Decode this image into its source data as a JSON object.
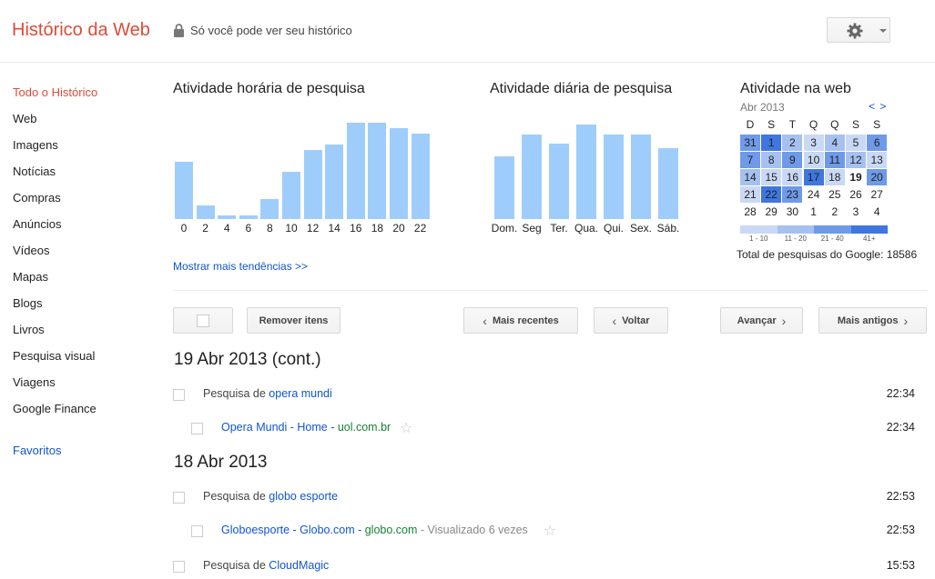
{
  "header": {
    "title": "Histórico da Web",
    "privacy_note": "Só você pode ver seu histórico"
  },
  "sidebar": {
    "items": [
      {
        "label": "Todo o Histórico",
        "active": true
      },
      {
        "label": "Web"
      },
      {
        "label": "Imagens"
      },
      {
        "label": "Notícias"
      },
      {
        "label": "Compras"
      },
      {
        "label": "Anúncios"
      },
      {
        "label": "Vídeos"
      },
      {
        "label": "Mapas"
      },
      {
        "label": "Blogs"
      },
      {
        "label": "Livros"
      },
      {
        "label": "Pesquisa visual"
      },
      {
        "label": "Viagens"
      },
      {
        "label": "Google Finance"
      }
    ],
    "favorites": "Favoritos"
  },
  "chart_data": [
    {
      "type": "bar",
      "title": "Atividade horária de pesquisa",
      "categories": [
        "0",
        "2",
        "4",
        "6",
        "8",
        "10",
        "12",
        "14",
        "16",
        "18",
        "20",
        "22"
      ],
      "values": [
        63,
        15,
        4,
        4,
        22,
        52,
        76,
        82,
        106,
        106,
        100,
        94
      ],
      "color": "#9fcdfb"
    },
    {
      "type": "bar",
      "title": "Atividade diária de pesquisa",
      "categories": [
        "Dom.",
        "Seg",
        "Ter.",
        "Qua.",
        "Qui.",
        "Sex.",
        "Sáb."
      ],
      "values": [
        69,
        93,
        83,
        104,
        93,
        93,
        78
      ],
      "color": "#9fcdfb"
    }
  ],
  "calendar": {
    "title": "Atividade na web",
    "month": "Abr 2013",
    "nav": "< >",
    "weekdays": [
      "D",
      "S",
      "T",
      "Q",
      "Q",
      "S",
      "S"
    ],
    "weeks": [
      [
        {
          "d": "31",
          "lvl": 3
        },
        {
          "d": "1",
          "lvl": 4
        },
        {
          "d": "2",
          "lvl": 2
        },
        {
          "d": "3",
          "lvl": 1
        },
        {
          "d": "4",
          "lvl": 2
        },
        {
          "d": "5",
          "lvl": 1
        },
        {
          "d": "6",
          "lvl": 3
        }
      ],
      [
        {
          "d": "7",
          "lvl": 3
        },
        {
          "d": "8",
          "lvl": 2
        },
        {
          "d": "9",
          "lvl": 3
        },
        {
          "d": "10",
          "lvl": 1
        },
        {
          "d": "11",
          "lvl": 3
        },
        {
          "d": "12",
          "lvl": 2
        },
        {
          "d": "13",
          "lvl": 1
        }
      ],
      [
        {
          "d": "14",
          "lvl": 2
        },
        {
          "d": "15",
          "lvl": 1
        },
        {
          "d": "16",
          "lvl": 1
        },
        {
          "d": "17",
          "lvl": 4
        },
        {
          "d": "18",
          "lvl": 1
        },
        {
          "d": "19",
          "lvl": 0,
          "bold": true
        },
        {
          "d": "20",
          "lvl": 3
        }
      ],
      [
        {
          "d": "21",
          "lvl": 1
        },
        {
          "d": "22",
          "lvl": 4
        },
        {
          "d": "23",
          "lvl": 3
        },
        {
          "d": "24",
          "lvl": 0
        },
        {
          "d": "25",
          "lvl": 0
        },
        {
          "d": "26",
          "lvl": 0
        },
        {
          "d": "27",
          "lvl": 0
        }
      ],
      [
        {
          "d": "28",
          "lvl": 0
        },
        {
          "d": "29",
          "lvl": 0
        },
        {
          "d": "30",
          "lvl": 0
        },
        {
          "d": "1",
          "lvl": 0
        },
        {
          "d": "2",
          "lvl": 0
        },
        {
          "d": "3",
          "lvl": 0
        },
        {
          "d": "4",
          "lvl": 0
        }
      ]
    ],
    "legend": [
      "1 - 10",
      "11 - 20",
      "21 - 40",
      "41+"
    ],
    "level_colors": [
      "#ffffff",
      "#c9d9f5",
      "#a6c1f0",
      "#6e9ae8",
      "#3f76df"
    ],
    "total": "Total de pesquisas do Google: 18586"
  },
  "more_trends": "Mostrar mais tendências >>",
  "toolbar": {
    "remove": "Remover itens",
    "newer": "Mais recentes",
    "back": "Voltar",
    "forward": "Avançar",
    "older": "Mais antigos"
  },
  "history": [
    {
      "date": "19 Abr 2013 (cont.)",
      "entries": [
        {
          "kind": "search",
          "prefix": "Pesquisa de",
          "query": "opera mundi",
          "time": "22:34"
        },
        {
          "kind": "page",
          "title": "Opera Mundi - Home",
          "sep": " - ",
          "domain": "uol.com.br",
          "meta": "",
          "time": "22:34"
        }
      ]
    },
    {
      "date": "18 Abr 2013",
      "entries": [
        {
          "kind": "search",
          "prefix": "Pesquisa de",
          "query": "globo esporte",
          "time": "22:53"
        },
        {
          "kind": "page",
          "title": "Globoesporte - Globo.com",
          "sep": " - ",
          "domain": "globo.com",
          "meta": " - Visualizado 6 vezes",
          "time": "22:53"
        },
        {
          "kind": "search",
          "prefix": "Pesquisa de",
          "query": "CloudMagic",
          "time": "15:53"
        }
      ]
    }
  ]
}
